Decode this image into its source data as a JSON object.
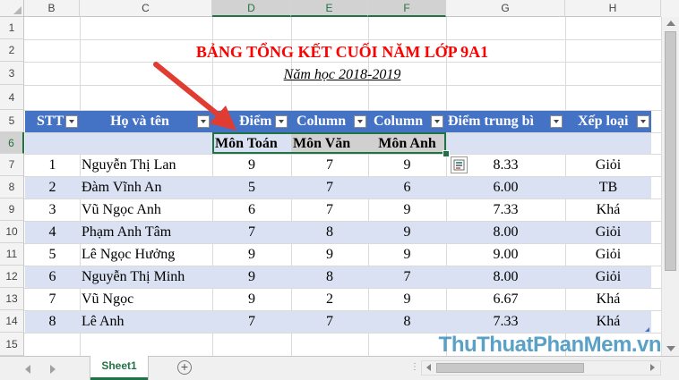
{
  "columns": [
    "B",
    "C",
    "D",
    "E",
    "F",
    "G",
    "H"
  ],
  "rows": [
    "1",
    "2",
    "3",
    "4",
    "5",
    "6",
    "7",
    "8",
    "9",
    "10",
    "11",
    "12",
    "13",
    "14",
    "15"
  ],
  "title": "BẢNG TỔNG KẾT CUỐI NĂM LỚP 9A1",
  "subtitle": "Năm học 2018-2019",
  "table_header": {
    "stt": "STT",
    "name": "Họ và tên",
    "diem": "Điểm",
    "col1": "Column",
    "col2": "Column",
    "dtb": "Điểm trung bì",
    "xeploai": "Xếp loại"
  },
  "subheader": {
    "mon1": "Môn Toán",
    "mon2": "Môn Văn",
    "mon3": "Môn Anh"
  },
  "students": [
    {
      "stt": "1",
      "name": "Nguyễn Thị Lan",
      "toan": "9",
      "van": "7",
      "anh": "9",
      "dtb": "8.33",
      "xl": "Giỏi"
    },
    {
      "stt": "2",
      "name": "Đàm Vĩnh An",
      "toan": "5",
      "van": "7",
      "anh": "6",
      "dtb": "6.00",
      "xl": "TB"
    },
    {
      "stt": "3",
      "name": "Vũ Ngọc Anh",
      "toan": "6",
      "van": "7",
      "anh": "9",
      "dtb": "7.33",
      "xl": "Khá"
    },
    {
      "stt": "4",
      "name": "Phạm Anh Tâm",
      "toan": "7",
      "van": "8",
      "anh": "9",
      "dtb": "8.00",
      "xl": "Giỏi"
    },
    {
      "stt": "5",
      "name": "Lê Ngọc Hưởng",
      "toan": "9",
      "van": "9",
      "anh": "9",
      "dtb": "9.00",
      "xl": "Giỏi"
    },
    {
      "stt": "6",
      "name": "Nguyễn Thị Minh",
      "toan": "9",
      "van": "8",
      "anh": "7",
      "dtb": "8.00",
      "xl": "Giỏi"
    },
    {
      "stt": "7",
      "name": "Vũ Ngọc",
      "toan": "9",
      "van": "2",
      "anh": "9",
      "dtb": "6.67",
      "xl": "Khá"
    },
    {
      "stt": "8",
      "name": "Lê Anh",
      "toan": "7",
      "van": "7",
      "anh": "8",
      "dtb": "7.33",
      "xl": "Khá"
    }
  ],
  "sheet_tab": "Sheet1",
  "watermark": "ThuThuatPhanMem.vn",
  "colors": {
    "header_blue": "#4472c4",
    "band": "#d9e1f2",
    "title_red": "#ff0000",
    "arrow_red": "#e03c31",
    "excel_green": "#217346"
  }
}
